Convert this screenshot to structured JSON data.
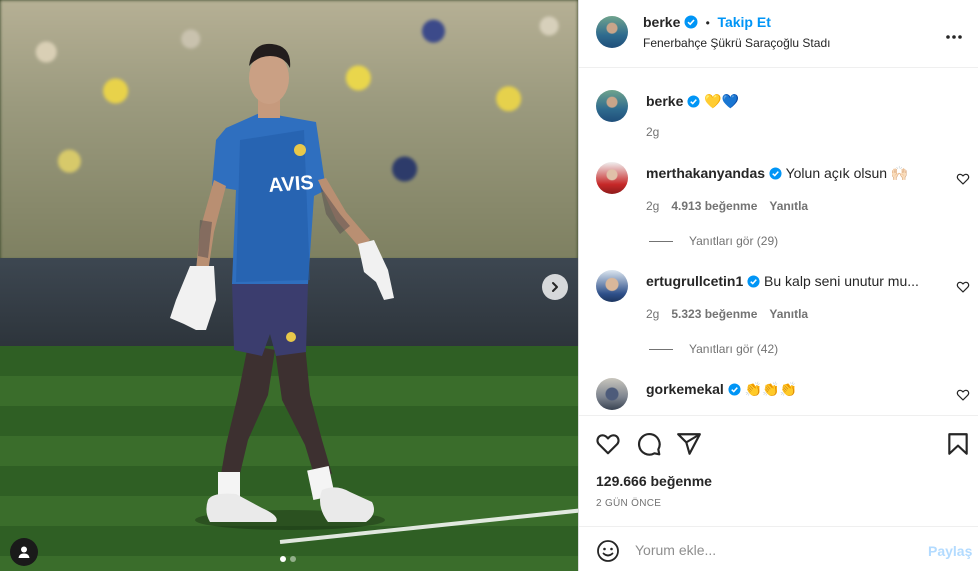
{
  "header": {
    "username": "berke",
    "follow_label": "Takip Et",
    "separator": "•",
    "location": "Fenerbahçe Şükrü Saraçoğlu Stadı",
    "more_icon": "more-horizontal-icon"
  },
  "caption": {
    "username": "berke",
    "text": "💛💙",
    "time": "2g"
  },
  "comments": [
    {
      "username": "merthakanyandas",
      "text": "Yolun açık olsun 🙌🏻",
      "time": "2g",
      "likes": "4.913 beğenme",
      "reply_label": "Yanıtla",
      "view_replies": "Yanıtları gör (29)"
    },
    {
      "username": "ertugrullcetin1",
      "text": "Bu kalp seni unutur mu...",
      "time": "2g",
      "likes": "5.323 beğenme",
      "reply_label": "Yanıtla",
      "view_replies": "Yanıtları gör (42)"
    },
    {
      "username": "gorkemekal",
      "text": "👏👏👏"
    }
  ],
  "actions": {
    "like_icon": "heart-icon",
    "comment_icon": "comment-icon",
    "share_icon": "send-icon",
    "save_icon": "bookmark-icon",
    "likes_count": "129.666 beğenme",
    "date": "2 GÜN ÖNCE"
  },
  "composer": {
    "placeholder": "Yorum ekle...",
    "post_label": "Paylaş",
    "emoji_icon": "emoji-icon"
  },
  "media": {
    "next_icon": "chevron-right-icon",
    "tag_icon": "user-tag-icon",
    "slide_count": 2,
    "active_slide": 1
  },
  "colors": {
    "accent": "#0095f6",
    "post_disabled": "#b3dbff",
    "muted": "#737373"
  }
}
